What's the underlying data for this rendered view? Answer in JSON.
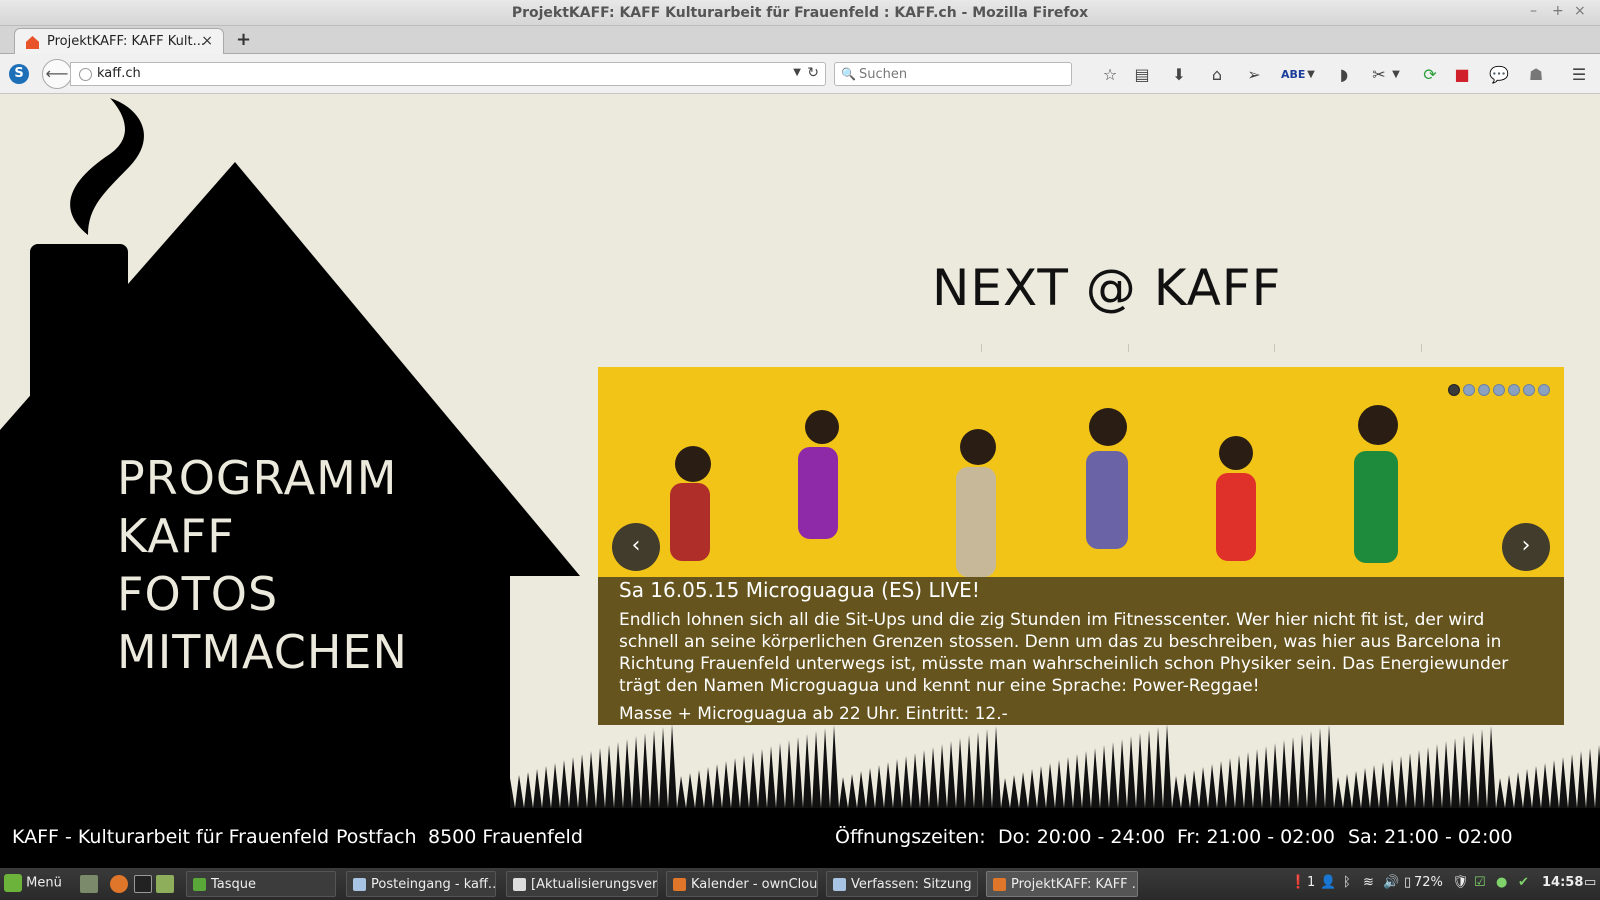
{
  "window": {
    "title": "ProjektKAFF: KAFF Kulturarbeit für Frauenfeld : KAFF.ch - Mozilla Firefox",
    "controls": [
      "–",
      "+",
      "×"
    ]
  },
  "browser": {
    "tab_label": "ProjektKAFF: KAFF Kult...",
    "tab_close": "×",
    "new_tab": "+",
    "url": "kaff.ch",
    "search_placeholder": "Suchen",
    "toolbar_icons": [
      "bookmark-star-icon",
      "reading-list-icon",
      "download-icon",
      "home-icon",
      "send-icon",
      "abp-icon",
      "pocket-icon",
      "screenshot-icon",
      "sync-icon",
      "addon-icon",
      "chat-icon",
      "privacy-icon",
      "menu-icon"
    ]
  },
  "page": {
    "nav": [
      "PROGRAMM",
      "KAFF",
      "FOTOS",
      "MITMACHEN"
    ],
    "heading": "NEXT @ KAFF",
    "slider": {
      "dot_count": 7,
      "active_dot": 0,
      "prev": "‹",
      "next": "›",
      "title": "Sa 16.05.15 Microguagua (ES) LIVE!",
      "description": "Endlich lohnen sich all die Sit-Ups und die zig Stunden im Fitnesscenter. Wer hier nicht fit ist, der wird schnell an seine körperlichen Grenzen stossen. Denn um das zu beschreiben, was hier aus Barcelona in Richtung Frauenfeld unterwegs ist, müsste man wahrscheinlich schon Physiker sein. Das Energiewunder trägt den Namen Microguagua und kennt nur eine Sprache: Power-Reggae!",
      "info": "Masse + Microguagua ab 22 Uhr. Eintritt: 12.-"
    },
    "footer": {
      "org": "KAFF - Kulturarbeit für Frauenfeld",
      "postfach": "Postfach",
      "city": "8500 Frauenfeld",
      "hours_label": "Öffnungszeiten:",
      "hours_do": "Do: 20:00 - 24:00",
      "hours_fr": "Fr: 21:00 - 02:00",
      "hours_sa": "Sa: 21:00 - 02:00"
    }
  },
  "taskbar": {
    "menu": "Menü",
    "tasks": [
      "Tasque",
      "Posteingang - kaff...",
      "[Aktualisierungsver...",
      "Kalender - ownClou...",
      "Verfassen: Sitzung ...",
      "ProjektKAFF: KAFF ..."
    ],
    "tray_notice": "1",
    "battery": "72%",
    "clock": "14:58"
  },
  "colors": {
    "page_bg": "#ece9dd",
    "slider_bg": "#f2c418",
    "house": "#000000",
    "nav_text": "#ece9dd"
  }
}
